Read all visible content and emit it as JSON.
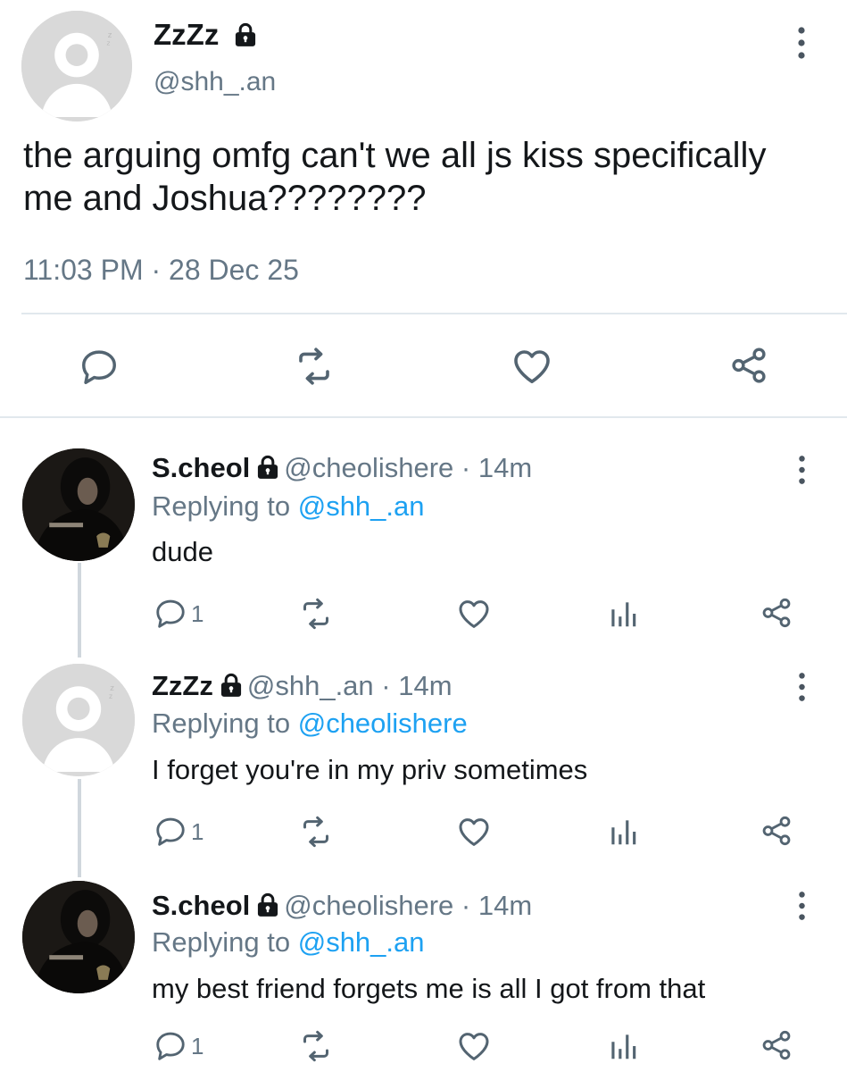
{
  "main_tweet": {
    "display_name": "ZzZz",
    "handle": "@shh_.an",
    "text_line1": "the arguing omfg can't we all js kiss specifically",
    "text_line2": "me and Joshua????????",
    "timestamp": "11:03 PM · 28 Dec 25"
  },
  "replies": [
    {
      "display_name": "S.cheol",
      "handle": "@cheolishere",
      "time": "· 14m",
      "replying_prefix": "Replying to",
      "replying_to": "@shh_.an",
      "text": "dude",
      "reply_count": "1"
    },
    {
      "display_name": "ZzZz",
      "handle": "@shh_.an",
      "time": "· 14m",
      "replying_prefix": "Replying to",
      "replying_to": "@cheolishere",
      "text": "I forget you're in my priv sometimes",
      "reply_count": "1"
    },
    {
      "display_name": "S.cheol",
      "handle": "@cheolishere",
      "time": "· 14m",
      "replying_prefix": "Replying to",
      "replying_to": "@shh_.an",
      "text": "my best friend forgets me is all I got from that",
      "reply_count": "1"
    }
  ],
  "colors": {
    "text": "#14171a",
    "muted": "#657786",
    "link": "#1da1f2",
    "icon": "#536471",
    "divider": "#e1e8ed",
    "thread_line": "#d0d7dd"
  },
  "icons": [
    "lock-icon",
    "more-icon",
    "reply-icon",
    "retweet-icon",
    "like-icon",
    "analytics-icon",
    "share-icon",
    "sleep-zz-icon"
  ]
}
